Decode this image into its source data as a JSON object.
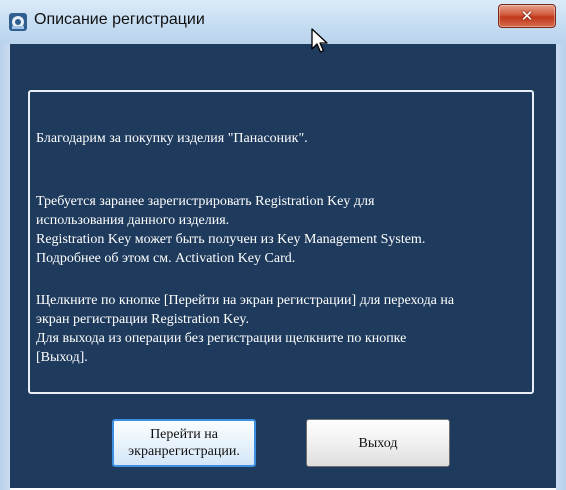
{
  "window": {
    "title": "Описание регистрации"
  },
  "message": {
    "lines": [
      "Благодарим за покупку изделия \"Панасоник\".",
      "Требуется заранее зарегистрировать Registration Key для",
      "использования данного изделия.",
      "Registration Key может быть получен из Key Management System.",
      "Подробнее об этом см. Activation Key Card.",
      "Щелкните по кнопке [Перейти на экран регистрации] для перехода на",
      "экран регистрации Registration Key.",
      "Для выхода из операции без регистрации щелкните по кнопке",
      "[Выход]."
    ]
  },
  "buttons": {
    "register_line1": "Перейти на",
    "register_line2": "экранрегистрации.",
    "exit": "Выход"
  },
  "colors": {
    "client_background": "#1e3a5c",
    "text": "#ffffff",
    "close_button": "#c0391b",
    "focus_border": "#3c8ee0"
  },
  "icons": {
    "title": "app-icon",
    "close": "close-icon",
    "cursor": "mouse-cursor-icon"
  }
}
